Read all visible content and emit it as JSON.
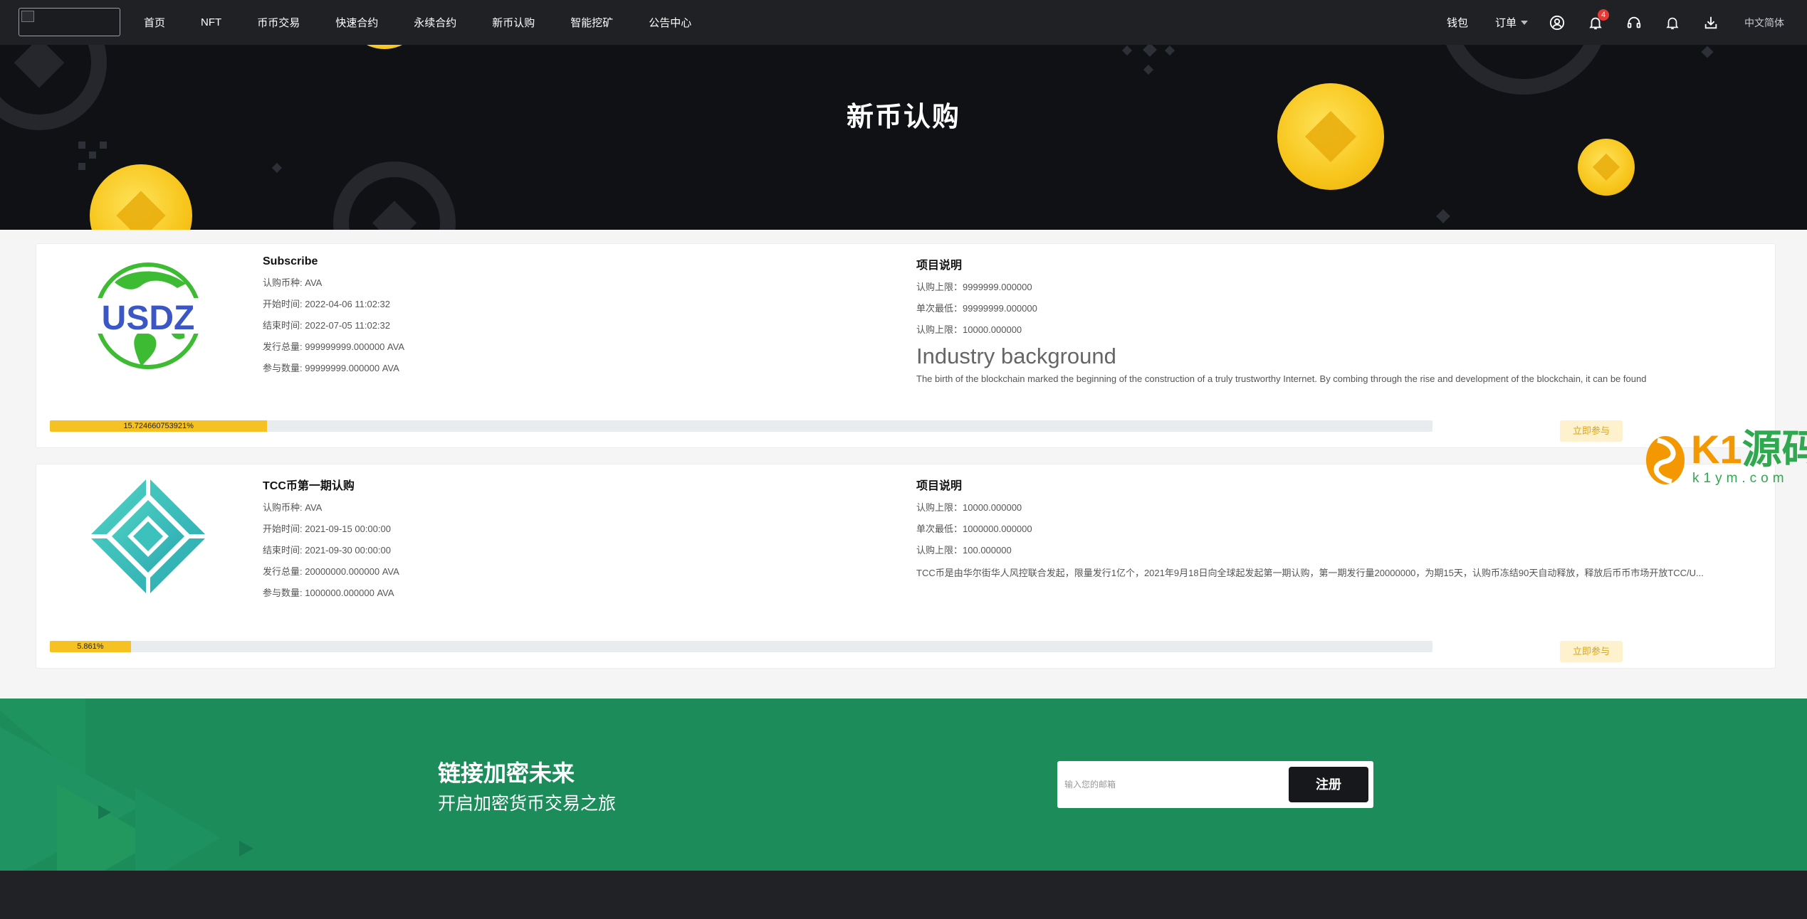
{
  "nav": {
    "items": [
      "首页",
      "NFT",
      "币币交易",
      "快速合约",
      "永续合约",
      "新币认购",
      "智能挖矿",
      "公告中心"
    ],
    "wallet": "钱包",
    "orders": "订单",
    "notification_count": "4",
    "language": "中文简体",
    "icons": [
      "user-icon",
      "bell-icon",
      "headset-icon",
      "bell-outline-icon",
      "download-icon"
    ]
  },
  "hero": {
    "title": "新币认购"
  },
  "cards": [
    {
      "title": "Subscribe",
      "logo_text": "USDZ",
      "rows": [
        {
          "label": "认购币种:",
          "value": "AVA"
        },
        {
          "label": "开始时间:",
          "value": "2022-04-06 11:02:32"
        },
        {
          "label": "结束时间:",
          "value": "2022-07-05 11:02:32"
        },
        {
          "label": "发行总量:",
          "value": "999999999.000000 AVA"
        },
        {
          "label": "参与数量:",
          "value": "99999999.000000 AVA"
        }
      ],
      "project_title": "项目说明",
      "project_rows": [
        {
          "label": "认购上限：",
          "value": "9999999.000000"
        },
        {
          "label": "单次最低：",
          "value": "99999999.000000"
        },
        {
          "label": "认购上限：",
          "value": "10000.000000"
        }
      ],
      "bg_title": "Industry background",
      "bg_text": "The birth of the blockchain marked the beginning of the construction of a truly trustworthy Internet. By combing through the rise and development of the blockchain, it can be found",
      "progress_label": "15.724660753921%",
      "progress": 15.724660753921,
      "join_label": "立即参与"
    },
    {
      "title": "TCC币第一期认购",
      "rows": [
        {
          "label": "认购币种:",
          "value": "AVA"
        },
        {
          "label": "开始时间:",
          "value": "2021-09-15 00:00:00"
        },
        {
          "label": "结束时间:",
          "value": "2021-09-30 00:00:00"
        },
        {
          "label": "发行总量:",
          "value": "20000000.000000 AVA"
        },
        {
          "label": "参与数量:",
          "value": "1000000.000000 AVA"
        }
      ],
      "project_title": "项目说明",
      "project_rows": [
        {
          "label": "认购上限：",
          "value": "10000.000000"
        },
        {
          "label": "单次最低：",
          "value": "1000000.000000"
        },
        {
          "label": "认购上限：",
          "value": "100.000000"
        }
      ],
      "desc_text": "TCC币是由华尔街华人风控联合发起，限量发行1亿个，2021年9月18日向全球起发起第一期认购，第一期发行量20000000，为期15天，认购币冻结90天自动释放，释放后币币市场开放TCC/U...",
      "progress_label": "5.861%",
      "progress": 5.861,
      "join_label": "立即参与"
    }
  ],
  "banner": {
    "title": "链接加密未来",
    "subtitle": "开启加密货币交易之旅",
    "email_placeholder": "输入您的邮箱",
    "register_label": "注册"
  },
  "watermark": {
    "brand": "K1",
    "brand_cn": "源码",
    "url": "k1ym.com"
  },
  "colors": {
    "accent": "#f6c223",
    "banner_green": "#1b8c5a",
    "nav_bg": "#1f2125",
    "hero_bg": "#0f1115"
  }
}
